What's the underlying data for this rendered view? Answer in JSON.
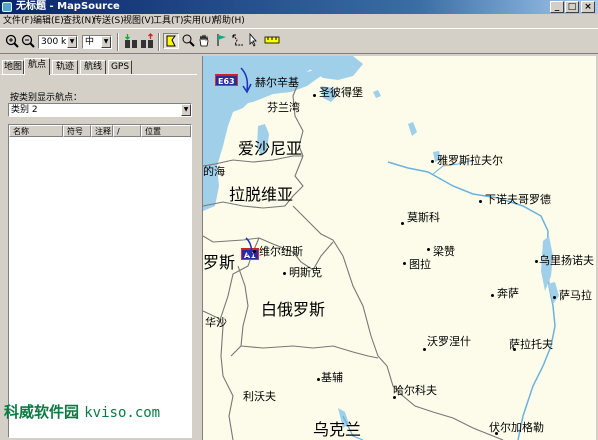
{
  "window": {
    "title": "无标题 - MapSource",
    "minimize": "_",
    "maximize": "□",
    "close": "×"
  },
  "menu": [
    "文件(F)",
    "编辑(E)",
    "查找(N)",
    "传送(S)",
    "视图(V)",
    "工具(T)",
    "实用(U)",
    "帮助(H)"
  ],
  "toolbar": {
    "zoom_in_icon": "zoom-in-icon",
    "zoom_out_icon": "zoom-out-icon",
    "scale_value": "300 km",
    "detail_value": "中"
  },
  "left_panel": {
    "tabs": [
      "地图",
      "航点",
      "轨迹",
      "航线",
      "GPS"
    ],
    "active_tab": "航点",
    "display_label": "按类别显示航点：",
    "category_value": "类别 2",
    "columns": [
      "名称",
      "符号",
      "注释",
      "/",
      "位置"
    ]
  },
  "map": {
    "places": [
      {
        "name": "赫尔辛基"
      },
      {
        "name": "芬兰湾"
      },
      {
        "name": "圣彼得堡"
      },
      {
        "name": "爱沙尼亚"
      },
      {
        "name": "的海"
      },
      {
        "name": "拉脱维亚"
      },
      {
        "name": "雅罗斯拉夫尔"
      },
      {
        "name": "下诺夫哥罗德"
      },
      {
        "name": "莫斯科"
      },
      {
        "name": "维尔纽斯"
      },
      {
        "name": "罗斯"
      },
      {
        "name": "明斯克"
      },
      {
        "name": "梁赞"
      },
      {
        "name": "图拉"
      },
      {
        "name": "乌里扬诺夫"
      },
      {
        "name": "白俄罗斯"
      },
      {
        "name": "奔萨"
      },
      {
        "name": "萨马拉"
      },
      {
        "name": "华沙"
      },
      {
        "name": "沃罗涅什"
      },
      {
        "name": "萨拉托夫"
      },
      {
        "name": "基辅"
      },
      {
        "name": "利沃夫"
      },
      {
        "name": "哈尔科夫"
      },
      {
        "name": "乌克兰"
      },
      {
        "name": "伏尔加格勒"
      }
    ],
    "shields": [
      "E63",
      "A1"
    ],
    "colors": {
      "land": "#fdfcea",
      "water": "#9fcfe9",
      "border": "#777777"
    }
  },
  "watermark": {
    "text": "科威软件园",
    "latin": "kviso.com"
  }
}
